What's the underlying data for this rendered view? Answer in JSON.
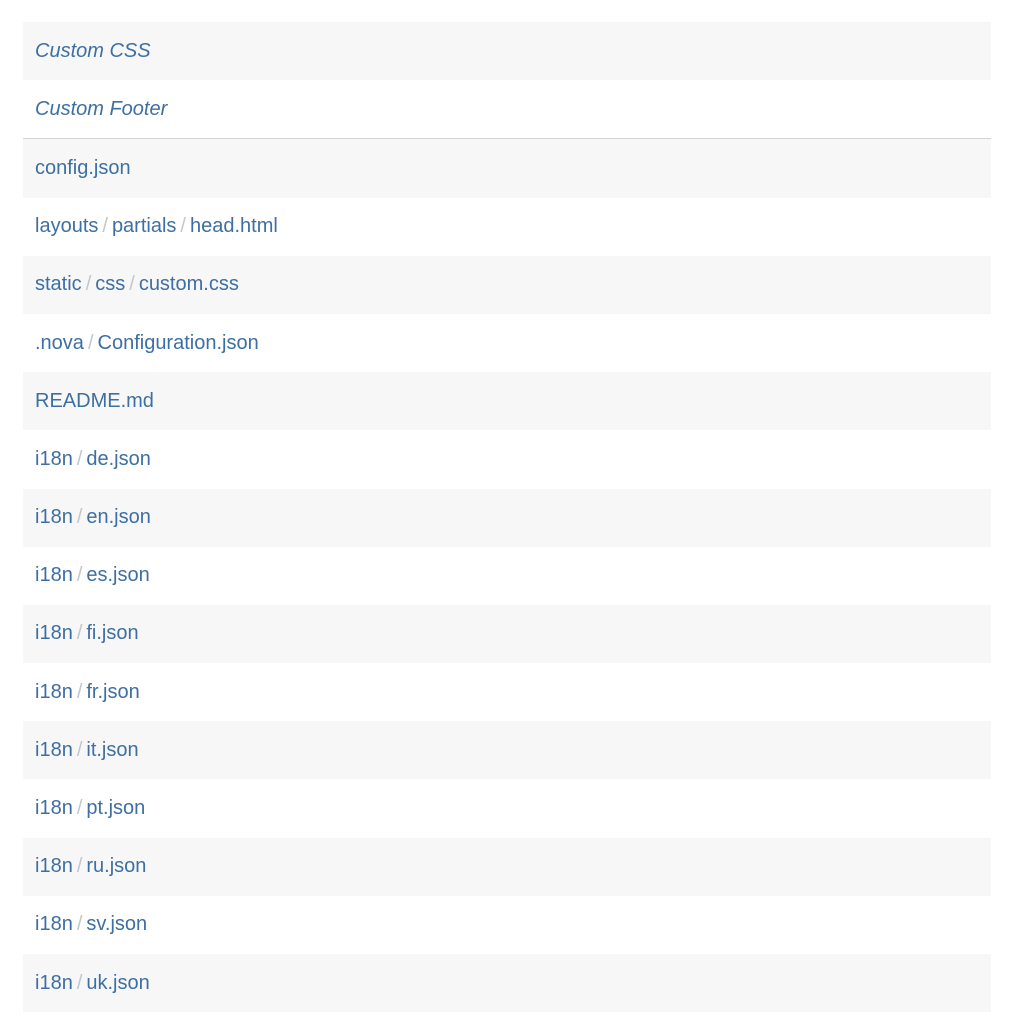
{
  "sections": [
    {
      "label": "Custom CSS"
    },
    {
      "label": "Custom Footer"
    }
  ],
  "files": [
    {
      "path": [
        "config.json"
      ]
    },
    {
      "path": [
        "layouts",
        "partials",
        "head.html"
      ]
    },
    {
      "path": [
        "static",
        "css",
        "custom.css"
      ]
    },
    {
      "path": [
        ".nova",
        "Configuration.json"
      ]
    },
    {
      "path": [
        "README.md"
      ]
    },
    {
      "path": [
        "i18n",
        "de.json"
      ]
    },
    {
      "path": [
        "i18n",
        "en.json"
      ]
    },
    {
      "path": [
        "i18n",
        "es.json"
      ]
    },
    {
      "path": [
        "i18n",
        "fi.json"
      ]
    },
    {
      "path": [
        "i18n",
        "fr.json"
      ]
    },
    {
      "path": [
        "i18n",
        "it.json"
      ]
    },
    {
      "path": [
        "i18n",
        "pt.json"
      ]
    },
    {
      "path": [
        "i18n",
        "ru.json"
      ]
    },
    {
      "path": [
        "i18n",
        "sv.json"
      ]
    },
    {
      "path": [
        "i18n",
        "uk.json"
      ]
    }
  ],
  "path_separator": "/",
  "colors": {
    "link": "#3d6fa3",
    "separator": "#c3c6ca",
    "row_shade": "#f7f7f8",
    "divider": "#d4d4d6"
  }
}
